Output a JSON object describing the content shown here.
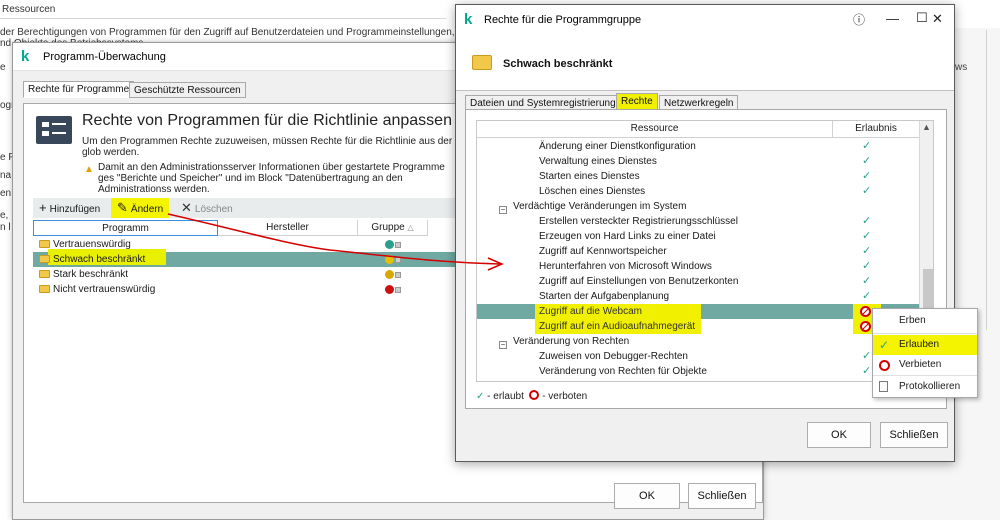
{
  "background": {
    "title": "Ressourcen",
    "desc_line1": "der Berechtigungen von Programmen für den Zugriff auf Benutzerdateien und Programmeinstellungen, s",
    "desc_line2": "nd Objekte des Betriebssystems",
    "frag1": "e",
    "frag2": "ogr",
    "frag3": "e F",
    "frag4": "na",
    "frag5": "en,",
    "frag6": "e,",
    "frag7": "n l",
    "right_text": "ws"
  },
  "mid_window": {
    "title": "Programm-Überwachung",
    "tabs": [
      "Rechte für Programme",
      "Geschützte Ressourcen"
    ],
    "heading": "Rechte von Programmen für die Richtlinie anpassen",
    "description": "Um den Programmen Rechte zuzuweisen, müssen Rechte für die Richtlinie aus der glob werden.",
    "warning": "Damit an den Administrationsserver Informationen über gestartete Programme ges \"Berichte und Speicher\" und im Block \"Datenübertragung an den Administrationss werden.",
    "toolbar": {
      "add": "Hinzufügen",
      "edit": "Ändern",
      "delete": "Löschen"
    },
    "columns": {
      "program": "Programm",
      "vendor": "Hersteller",
      "group": "Gruppe"
    },
    "groups": [
      {
        "name": "Vertrauenswürdig",
        "color": "#2aa08c"
      },
      {
        "name": "Schwach beschränkt",
        "color": "#e8c000"
      },
      {
        "name": "Stark beschränkt",
        "color": "#d8a800"
      },
      {
        "name": "Nicht vertrauenswürdig",
        "color": "#cc1111"
      }
    ],
    "ok": "OK",
    "close": "Schließen"
  },
  "dialog": {
    "title": "Rechte für die Programmgruppe",
    "group_name": "Schwach beschränkt",
    "tabs": [
      "Dateien und Systemregistrierung",
      "Rechte",
      "Netzwerkregeln"
    ],
    "columns": {
      "resource": "Ressource",
      "permission": "Erlaubnis"
    },
    "rows": [
      {
        "label": "Änderung einer Dienstkonfiguration",
        "level": 2,
        "perm": "allow"
      },
      {
        "label": "Verwaltung eines Dienstes",
        "level": 2,
        "perm": "allow"
      },
      {
        "label": "Starten eines Dienstes",
        "level": 2,
        "perm": "allow"
      },
      {
        "label": "Löschen eines Dienstes",
        "level": 2,
        "perm": "allow"
      },
      {
        "label": "Verdächtige Veränderungen im System",
        "level": 1,
        "perm": ""
      },
      {
        "label": "Erstellen versteckter Registrierungsschlüssel",
        "level": 2,
        "perm": "allow"
      },
      {
        "label": "Erzeugen von Hard Links zu einer Datei",
        "level": 2,
        "perm": "allow"
      },
      {
        "label": "Zugriff auf Kennwortspeicher",
        "level": 2,
        "perm": "allow"
      },
      {
        "label": "Herunterfahren von Microsoft Windows",
        "level": 2,
        "perm": "allow"
      },
      {
        "label": "Zugriff auf Einstellungen von Benutzerkonten",
        "level": 2,
        "perm": "allow"
      },
      {
        "label": "Starten der Aufgabenplanung",
        "level": 2,
        "perm": "allow"
      },
      {
        "label": "Zugriff auf die Webcam",
        "level": 2,
        "perm": "deny"
      },
      {
        "label": "Zugriff auf ein Audioaufnahmegerät",
        "level": 2,
        "perm": "deny"
      },
      {
        "label": "Veränderung von Rechten",
        "level": 1,
        "perm": ""
      },
      {
        "label": "Zuweisen von Debugger-Rechten",
        "level": 2,
        "perm": "allow"
      },
      {
        "label": "Veränderung von Rechten für Objekte",
        "level": 2,
        "perm": "allow"
      }
    ],
    "legend": {
      "allowed": "- erlaubt",
      "forbidden": "- verboten"
    },
    "ok": "OK",
    "close": "Schließen"
  },
  "context_menu": {
    "items": [
      "Erben",
      "Erlauben",
      "Verbieten",
      "Protokollieren"
    ]
  },
  "colors": {
    "accent_teal": "#2aa08c",
    "selection": "#6fa9a2",
    "highlight_yellow": "#f0f000",
    "annotation_red": "#d40000"
  }
}
